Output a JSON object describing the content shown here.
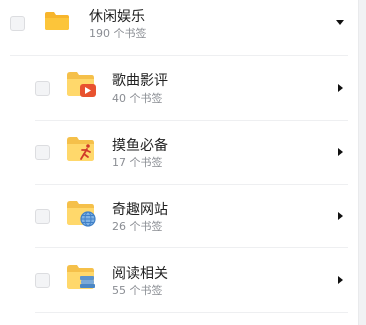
{
  "parent": {
    "title": "休闲娱乐",
    "count": "190 个书签",
    "icon": "folder-icon",
    "expanded": true
  },
  "children": [
    {
      "title": "歌曲影评",
      "count": "40 个书签",
      "icon": "video-play-icon",
      "badge_color": "#e8522f"
    },
    {
      "title": "摸鱼必备",
      "count": "17 个书签",
      "icon": "running-person-icon",
      "badge_color": "#d13a2a"
    },
    {
      "title": "奇趣网站",
      "count": "26 个书签",
      "icon": "globe-icon",
      "badge_color": "#3f7fc7"
    },
    {
      "title": "阅读相关",
      "count": "55 个书签",
      "icon": "books-icon",
      "badge_color": "#4a86c5"
    }
  ],
  "colors": {
    "folder": "#fcc53a",
    "folder_light": "#ffdb75"
  }
}
